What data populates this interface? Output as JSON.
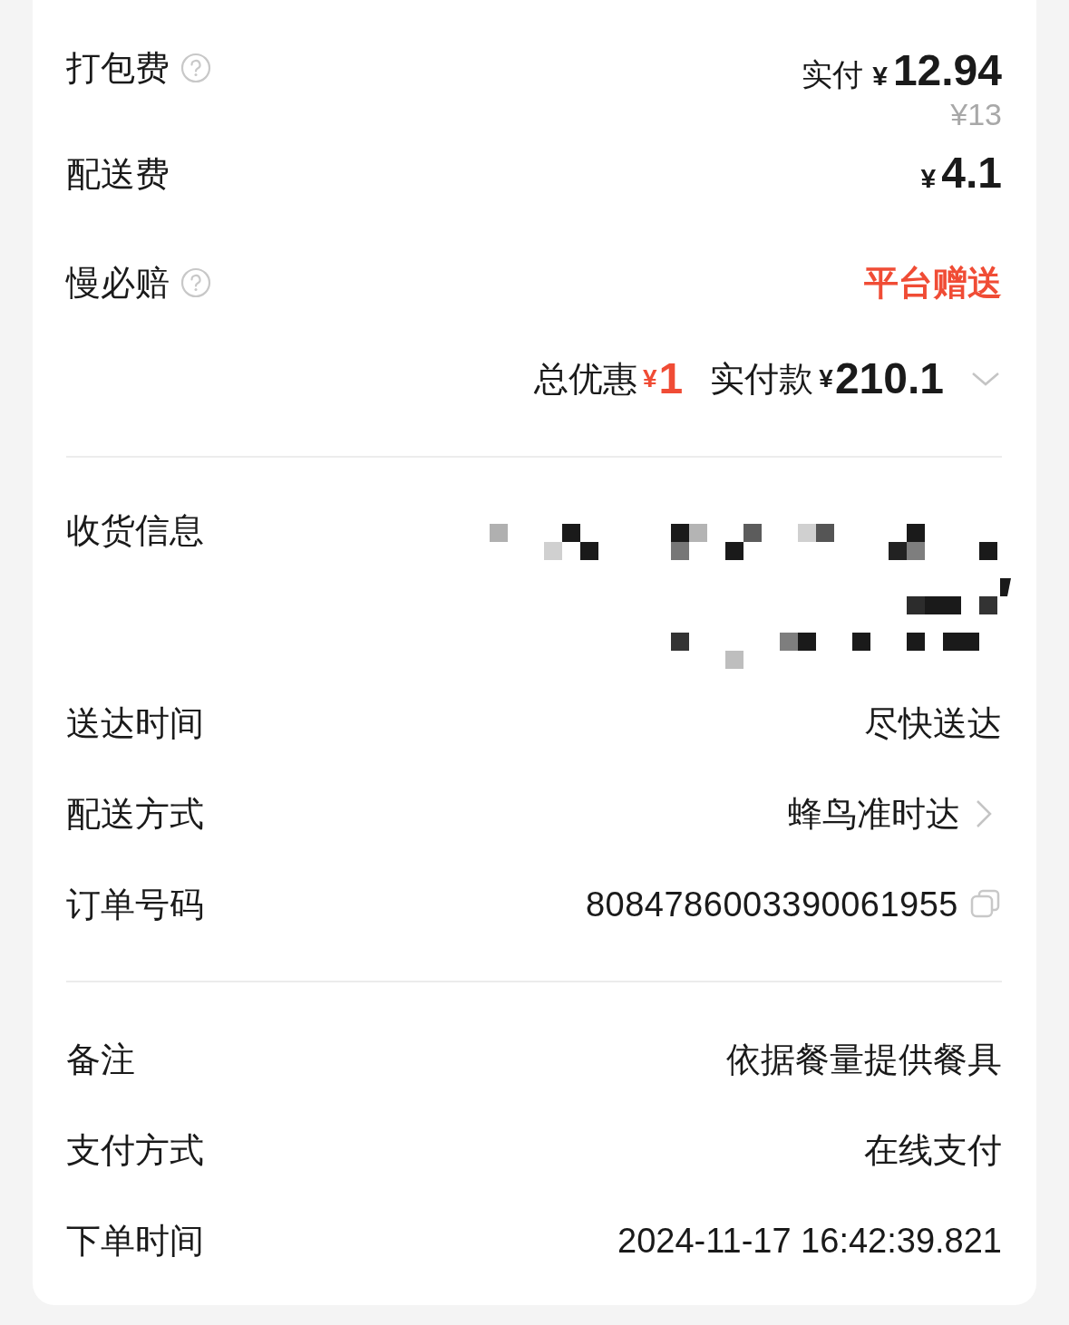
{
  "fees": [
    {
      "label": "打包费",
      "help": true,
      "kind": "price",
      "prefix": "实付",
      "currency": "¥",
      "amount": "12.94",
      "original": "¥13"
    },
    {
      "label": "配送费",
      "help": false,
      "kind": "price",
      "currency": "¥",
      "amount": "4.1"
    },
    {
      "label": "慢必赔",
      "help": true,
      "kind": "promo",
      "value": "平台赠送"
    }
  ],
  "summary": {
    "discount_label": "总优惠",
    "discount_currency": "¥",
    "discount": "1",
    "paid_label": "实付款",
    "paid_currency": "¥",
    "paid": "210.1",
    "expanded": false
  },
  "delivery": [
    {
      "label": "收货信息",
      "kind": "redacted"
    },
    {
      "label": "送达时间",
      "kind": "text",
      "value": "尽快送达"
    },
    {
      "label": "配送方式",
      "kind": "link",
      "value": "蜂鸟准时达"
    },
    {
      "label": "订单号码",
      "kind": "copy",
      "value": "8084786003390061955"
    }
  ],
  "order": [
    {
      "label": "备注",
      "value": "依据餐量提供餐具"
    },
    {
      "label": "支付方式",
      "value": "在线支付"
    },
    {
      "label": "下单时间",
      "value": "2024-11-17 16:42:39.821"
    }
  ]
}
